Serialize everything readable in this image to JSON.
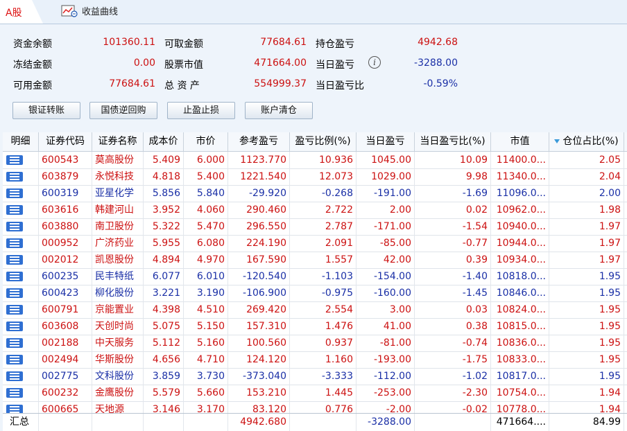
{
  "tabs": {
    "a_share": "A股",
    "profit_curve": "收益曲线"
  },
  "summary": {
    "balance_label": "资金余额",
    "balance": "101360.11",
    "withdrawable_label": "可取金额",
    "withdrawable": "77684.61",
    "position_pl_label": "持仓盈亏",
    "position_pl": "4942.68",
    "frozen_label": "冻结金额",
    "frozen": "0.00",
    "market_value_label": "股票市值",
    "market_value": "471664.00",
    "daily_pl_label": "当日盈亏",
    "daily_pl": "-3288.00",
    "available_label": "可用金额",
    "available": "77684.61",
    "total_assets_label": "总 资 产",
    "total_assets": "554999.37",
    "daily_pl_ratio_label": "当日盈亏比",
    "daily_pl_ratio": "-0.59%"
  },
  "buttons": {
    "transfer": "银证转账",
    "repo": "国债逆回购",
    "stop": "止盈止损",
    "clear": "账户清仓"
  },
  "columns": [
    "明细",
    "证券代码",
    "证券名称",
    "成本价",
    "市价",
    "参考盈亏",
    "盈亏比例(%)",
    "当日盈亏",
    "当日盈亏比(%)",
    "市值",
    "仓位占比(%)"
  ],
  "rows": [
    {
      "code": "600543",
      "name": "莫高股份",
      "cost": "5.409",
      "price": "6.000",
      "pl": "1123.770",
      "pl_pct": "10.936",
      "day_pl": "1045.00",
      "day_pct": "10.09",
      "mv": "11400.0...",
      "pos": "2.05",
      "color": "red"
    },
    {
      "code": "603879",
      "name": "永悦科技",
      "cost": "4.818",
      "price": "5.400",
      "pl": "1221.540",
      "pl_pct": "12.073",
      "day_pl": "1029.00",
      "day_pct": "9.98",
      "mv": "11340.0...",
      "pos": "2.04",
      "color": "red"
    },
    {
      "code": "600319",
      "name": "亚星化学",
      "cost": "5.856",
      "price": "5.840",
      "pl": "-29.920",
      "pl_pct": "-0.268",
      "day_pl": "-191.00",
      "day_pct": "-1.69",
      "mv": "11096.0...",
      "pos": "2.00",
      "color": "blue"
    },
    {
      "code": "603616",
      "name": "韩建河山",
      "cost": "3.952",
      "price": "4.060",
      "pl": "290.460",
      "pl_pct": "2.722",
      "day_pl": "2.00",
      "day_pct": "0.02",
      "mv": "10962.0...",
      "pos": "1.98",
      "color": "red"
    },
    {
      "code": "603880",
      "name": "南卫股份",
      "cost": "5.322",
      "price": "5.470",
      "pl": "296.550",
      "pl_pct": "2.787",
      "day_pl": "-171.00",
      "day_pct": "-1.54",
      "mv": "10940.0...",
      "pos": "1.97",
      "color": "red"
    },
    {
      "code": "000952",
      "name": "广济药业",
      "cost": "5.955",
      "price": "6.080",
      "pl": "224.190",
      "pl_pct": "2.091",
      "day_pl": "-85.00",
      "day_pct": "-0.77",
      "mv": "10944.0...",
      "pos": "1.97",
      "color": "red"
    },
    {
      "code": "002012",
      "name": "凯恩股份",
      "cost": "4.894",
      "price": "4.970",
      "pl": "167.590",
      "pl_pct": "1.557",
      "day_pl": "42.00",
      "day_pct": "0.39",
      "mv": "10934.0...",
      "pos": "1.97",
      "color": "red"
    },
    {
      "code": "600235",
      "name": "民丰特纸",
      "cost": "6.077",
      "price": "6.010",
      "pl": "-120.540",
      "pl_pct": "-1.103",
      "day_pl": "-154.00",
      "day_pct": "-1.40",
      "mv": "10818.0...",
      "pos": "1.95",
      "color": "blue"
    },
    {
      "code": "600423",
      "name": "柳化股份",
      "cost": "3.221",
      "price": "3.190",
      "pl": "-106.900",
      "pl_pct": "-0.975",
      "day_pl": "-160.00",
      "day_pct": "-1.45",
      "mv": "10846.0...",
      "pos": "1.95",
      "color": "blue"
    },
    {
      "code": "600791",
      "name": "京能置业",
      "cost": "4.398",
      "price": "4.510",
      "pl": "269.420",
      "pl_pct": "2.554",
      "day_pl": "3.00",
      "day_pct": "0.03",
      "mv": "10824.0...",
      "pos": "1.95",
      "color": "red"
    },
    {
      "code": "603608",
      "name": "天创时尚",
      "cost": "5.075",
      "price": "5.150",
      "pl": "157.310",
      "pl_pct": "1.476",
      "day_pl": "41.00",
      "day_pct": "0.38",
      "mv": "10815.0...",
      "pos": "1.95",
      "color": "red"
    },
    {
      "code": "002188",
      "name": "中天服务",
      "cost": "5.112",
      "price": "5.160",
      "pl": "100.560",
      "pl_pct": "0.937",
      "day_pl": "-81.00",
      "day_pct": "-0.74",
      "mv": "10836.0...",
      "pos": "1.95",
      "color": "red"
    },
    {
      "code": "002494",
      "name": "华斯股份",
      "cost": "4.656",
      "price": "4.710",
      "pl": "124.120",
      "pl_pct": "1.160",
      "day_pl": "-193.00",
      "day_pct": "-1.75",
      "mv": "10833.0...",
      "pos": "1.95",
      "color": "red"
    },
    {
      "code": "002775",
      "name": "文科股份",
      "cost": "3.859",
      "price": "3.730",
      "pl": "-373.040",
      "pl_pct": "-3.333",
      "day_pl": "-112.00",
      "day_pct": "-1.02",
      "mv": "10817.0...",
      "pos": "1.95",
      "color": "blue"
    },
    {
      "code": "600232",
      "name": "金鹰股份",
      "cost": "5.579",
      "price": "5.660",
      "pl": "153.210",
      "pl_pct": "1.445",
      "day_pl": "-253.00",
      "day_pct": "-2.30",
      "mv": "10754.0...",
      "pos": "1.94",
      "color": "red"
    },
    {
      "code": "600665",
      "name": "天地源",
      "cost": "3.146",
      "price": "3.170",
      "pl": "83.120",
      "pl_pct": "0.776",
      "day_pl": "-2.00",
      "day_pct": "-0.02",
      "mv": "10778.0...",
      "pos": "1.94",
      "color": "red"
    }
  ],
  "totals": {
    "label": "汇总",
    "pl": "4942.680",
    "day_pl": "-3288.00",
    "mv": "471664....",
    "pos": "84.99"
  },
  "colors": {
    "up": "#cc1111",
    "down": "#1a2fa6",
    "detail_icon": "#2f6fd2"
  }
}
